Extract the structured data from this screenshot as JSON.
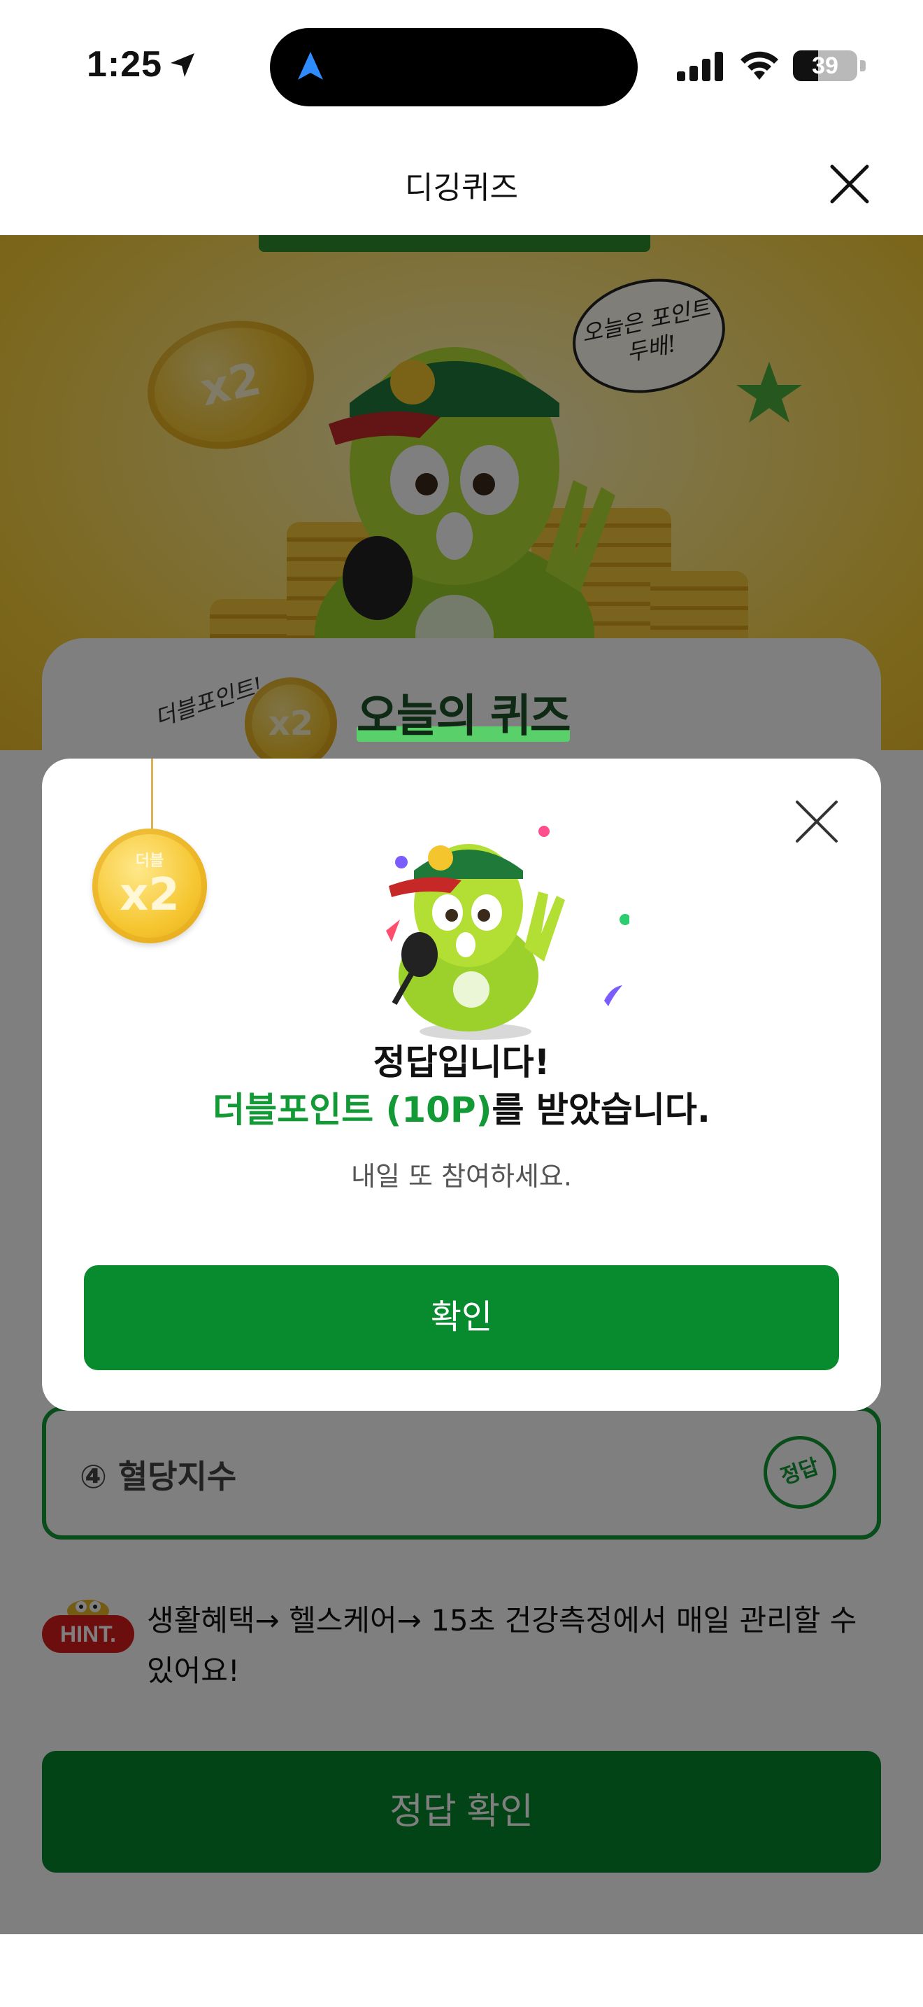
{
  "status_bar": {
    "time": "1:25",
    "battery": "39",
    "battery_level": 0.39
  },
  "header": {
    "title": "디깅퀴즈"
  },
  "hero": {
    "coin_label": "x2",
    "speech_line1": "오늘은 포인트",
    "speech_line2": "두배!"
  },
  "quiz_card": {
    "title": "오늘의 퀴즈",
    "double_script": "더블포인트!",
    "badge_text": "x2",
    "option": {
      "text": "④ 혈당지수",
      "stamp": "정답"
    }
  },
  "hint": {
    "badge": "HINT.",
    "text": "생활혜택→ 헬스케어→ 15초 건강측정에서 매일 관리할 수 있어요!"
  },
  "check_button": {
    "label": "정답 확인"
  },
  "modal": {
    "medal_label": "더블",
    "medal_text": "x2",
    "line1": "정답입니다!",
    "line2_accent": "더블포인트 (10P)",
    "line2_rest": "를 받았습니다.",
    "subtitle": "내일 또 참여하세요.",
    "confirm_label": "확인"
  },
  "colors": {
    "brand_green": "#088a2e",
    "accent_green": "#139a36",
    "hint_red": "#d81d1d",
    "banner_yellow": "#f7cf3a"
  }
}
